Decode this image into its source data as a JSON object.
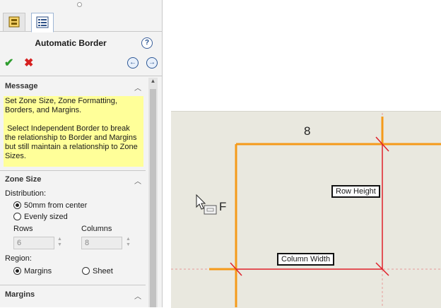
{
  "property_manager": {
    "title": "Automatic Border",
    "help_icon": "help-icon",
    "ok_icon": "check-icon",
    "cancel_icon": "close-icon",
    "back_icon": "back-arrow-icon",
    "forward_icon": "forward-arrow-icon"
  },
  "message": {
    "heading": "Message",
    "text": "Set Zone Size, Zone Formatting, Borders, and Margins.\n\n Select Independent Border to break the relationship to Border and Margins but still maintain a relationship to Zone Sizes."
  },
  "zone_size": {
    "heading": "Zone Size",
    "distribution_label": "Distribution:",
    "options": [
      "50mm from center",
      "Evenly sized"
    ],
    "selected_option": "50mm from center",
    "rows_label": "Rows",
    "rows_value": "6",
    "columns_label": "Columns",
    "columns_value": "8",
    "region_label": "Region:",
    "region_options": [
      "Margins",
      "Sheet"
    ],
    "selected_region": "Margins"
  },
  "margins": {
    "heading": "Margins"
  },
  "drawing": {
    "zone_number": "8",
    "row_height_label": "Row Height",
    "column_width_label": "Column Width",
    "cursor_letter": "F"
  },
  "colors": {
    "border_orange": "#f59a1a",
    "guide_red": "#e0202a",
    "message_bg": "#ffff99",
    "sheet_bg": "#e9e8df"
  }
}
